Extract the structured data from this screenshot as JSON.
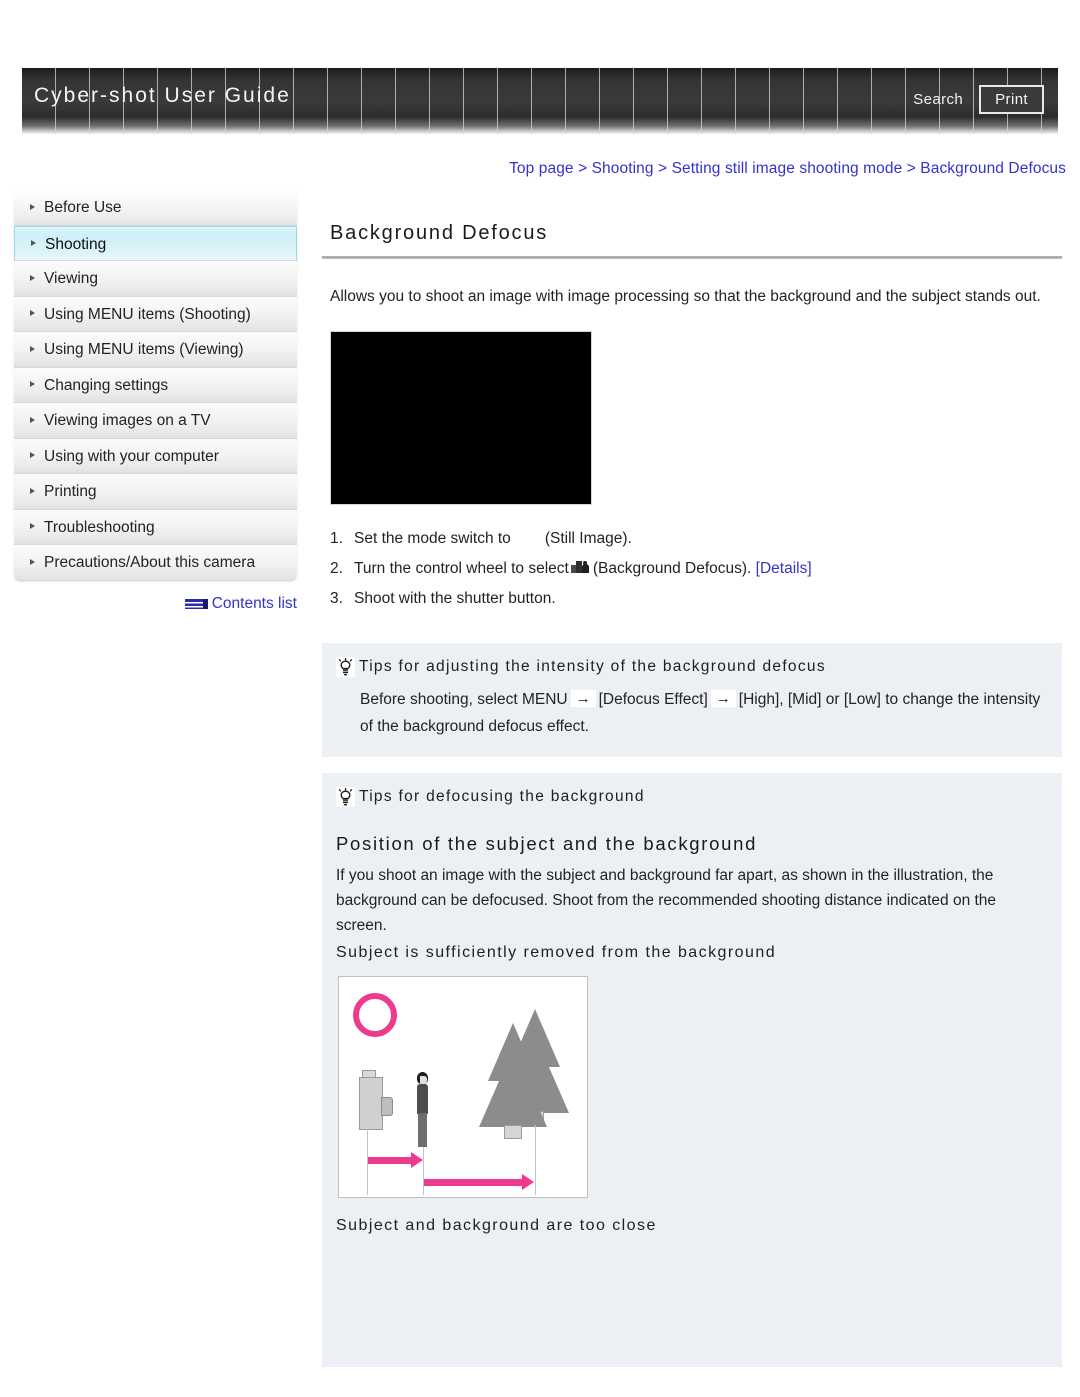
{
  "header": {
    "title": "Cyber-shot User Guide",
    "search_label": "Search",
    "print_label": "Print"
  },
  "breadcrumb": {
    "text": "Top page > Shooting > Setting still image shooting mode > Background Defocus"
  },
  "sidebar": {
    "items": [
      {
        "label": "Before Use"
      },
      {
        "label": "Shooting"
      },
      {
        "label": "Viewing"
      },
      {
        "label": "Using MENU items (Shooting)"
      },
      {
        "label": "Using MENU items (Viewing)"
      },
      {
        "label": "Changing settings"
      },
      {
        "label": "Viewing images on a TV"
      },
      {
        "label": "Using with your computer"
      },
      {
        "label": "Printing"
      },
      {
        "label": "Troubleshooting"
      },
      {
        "label": "Precautions/About this camera"
      }
    ],
    "contents_link": "Contents list"
  },
  "main": {
    "title": "Background Defocus",
    "intro": "Allows you to shoot an image with image processing so that the background and the subject stands out.",
    "steps": [
      {
        "num": "1.",
        "text_before": "Set the mode switch to",
        "text_after": "(Still Image).",
        "icon": "still-image-icon"
      },
      {
        "num": "2.",
        "text_before": "Turn the control wheel to select",
        "text_after": "(Background Defocus).",
        "link": "[Details]",
        "icon": "background-defocus-icon"
      },
      {
        "num": "3.",
        "text_before": "Shoot with the shutter button.",
        "text_after": "",
        "icon": ""
      }
    ],
    "tip1": {
      "heading": "Tips for adjusting the intensity of the background defocus",
      "body_part1": "Before shooting, select MENU",
      "arrow1": "→",
      "body_part2": "[Defocus Effect]",
      "arrow2": "→",
      "body_part3": "[High], [Mid] or [Low] to change the intensity of the background defocus effect."
    },
    "tip2": {
      "heading": "Tips for defocusing the background",
      "section_heading": "Position of the subject and the background",
      "section_para": "If you shoot an image with the subject and background far apart, as shown in the illustration, the background can be defocused. Shoot from the recommended shooting distance indicated on the screen.",
      "sub_heading_1": "Subject is sufficiently removed from the background",
      "sub_heading_2": "Subject and background are too close"
    }
  },
  "colors": {
    "link": "#3333cc",
    "accent_pink": "#ee3a8c",
    "tip_bg": "#eceff4",
    "active_nav": "#cfeff9"
  }
}
